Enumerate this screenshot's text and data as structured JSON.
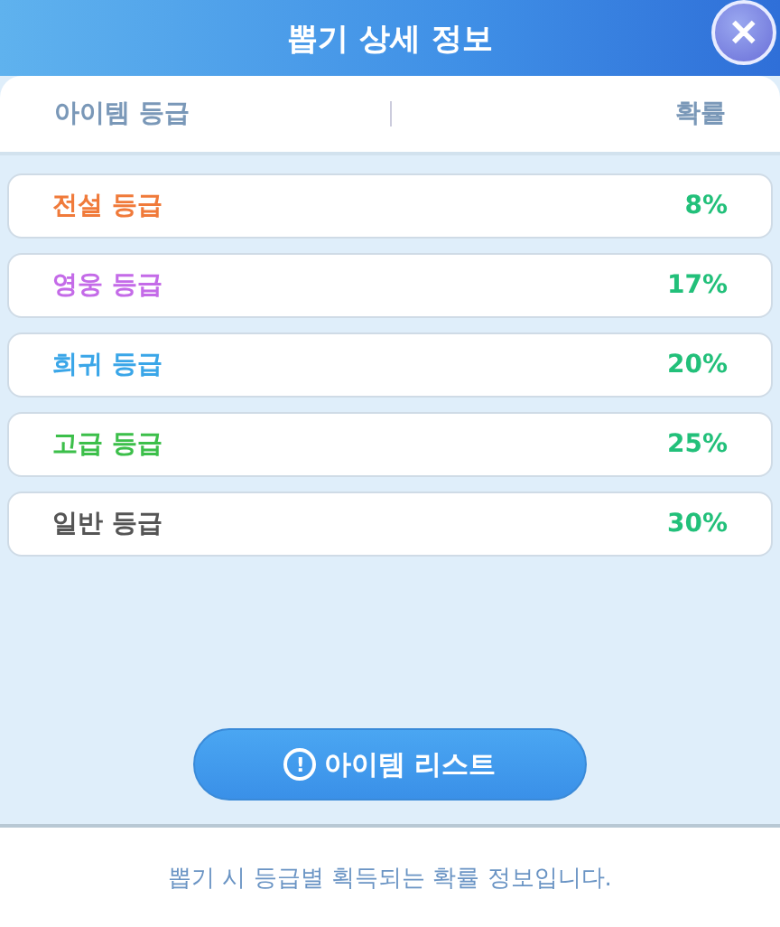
{
  "window": {
    "title": "뽑기 상세 정보",
    "close": "✕"
  },
  "columns": [
    "아이템 등급",
    "확률"
  ],
  "grades": [
    {
      "label": "전설 등급",
      "color": "#f07a3a",
      "rate": "8%"
    },
    {
      "label": "영웅 등급",
      "color": "#c46be8",
      "rate": "17%"
    },
    {
      "label": "희귀 등급",
      "color": "#3aa6e8",
      "rate": "20%"
    },
    {
      "label": "고급 등급",
      "color": "#3cbf4a",
      "rate": "25%"
    },
    {
      "label": "일반 등급",
      "color": "#555555",
      "rate": "30%"
    }
  ],
  "button": {
    "icon": "!",
    "label": "아이템 리스트"
  },
  "footer": "뽑기 시 등급별 획득되는 확률 정보입니다."
}
